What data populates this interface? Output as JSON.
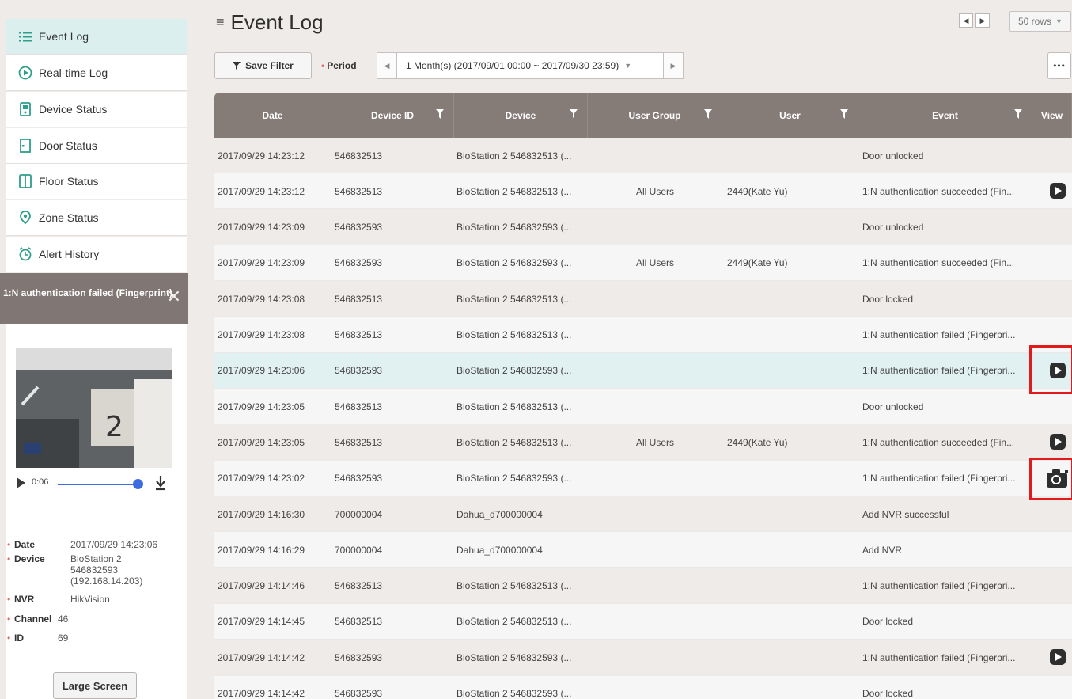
{
  "sidebar": {
    "items": [
      {
        "label": "Event Log",
        "icon": "list-icon",
        "active": true
      },
      {
        "label": "Real-time Log",
        "icon": "play-circle-icon"
      },
      {
        "label": "Device Status",
        "icon": "device-icon"
      },
      {
        "label": "Door Status",
        "icon": "door-icon"
      },
      {
        "label": "Floor Status",
        "icon": "floor-icon"
      },
      {
        "label": "Zone Status",
        "icon": "zone-pin-icon"
      },
      {
        "label": "Alert History",
        "icon": "alarm-clock-icon"
      }
    ],
    "alert": {
      "title": "1:N authentication failed (Fingerprint)",
      "close_icon": "close-icon"
    },
    "player": {
      "time": "0:06",
      "progress_fraction": 0.92
    },
    "details": [
      {
        "key": "Date",
        "value": "2017/09/29 14:23:06"
      },
      {
        "key": "Device",
        "value": "BioStation 2 546832593 (192.168.14.203)"
      },
      {
        "key": "NVR",
        "value": "HikVision"
      },
      {
        "key": "Channel",
        "value": "46"
      },
      {
        "key": "ID",
        "value": "69"
      }
    ],
    "large_screen_label": "Large Screen"
  },
  "header": {
    "title": "Event Log",
    "rows_label": "50 rows",
    "save_filter_label": "Save Filter",
    "period_label": "Period",
    "period_value": "1 Month(s) (2017/09/01 00:00 ~ 2017/09/30 23:59)",
    "more_label": "•••"
  },
  "table": {
    "columns": [
      "Date",
      "Device ID",
      "Device",
      "User Group",
      "User",
      "Event",
      "View"
    ],
    "rows": [
      {
        "date": "2017/09/29 14:23:12",
        "device_id": "546832513",
        "device": "BioStation 2 546832513 (...",
        "user_group": "",
        "user": "",
        "event": "Door unlocked",
        "view": ""
      },
      {
        "date": "2017/09/29 14:23:12",
        "device_id": "546832513",
        "device": "BioStation 2 546832513 (...",
        "user_group": "All Users",
        "user": "2449(Kate Yu)",
        "event": "1:N authentication succeeded (Fin...",
        "view": "video"
      },
      {
        "date": "2017/09/29 14:23:09",
        "device_id": "546832593",
        "device": "BioStation 2 546832593 (...",
        "user_group": "",
        "user": "",
        "event": "Door unlocked",
        "view": ""
      },
      {
        "date": "2017/09/29 14:23:09",
        "device_id": "546832593",
        "device": "BioStation 2 546832593 (...",
        "user_group": "All Users",
        "user": "2449(Kate Yu)",
        "event": "1:N authentication succeeded (Fin...",
        "view": ""
      },
      {
        "date": "2017/09/29 14:23:08",
        "device_id": "546832513",
        "device": "BioStation 2 546832513 (...",
        "user_group": "",
        "user": "",
        "event": "Door locked",
        "view": ""
      },
      {
        "date": "2017/09/29 14:23:08",
        "device_id": "546832513",
        "device": "BioStation 2 546832513 (...",
        "user_group": "",
        "user": "",
        "event": "1:N authentication failed (Fingerpri...",
        "view": ""
      },
      {
        "date": "2017/09/29 14:23:06",
        "device_id": "546832593",
        "device": "BioStation 2 546832593 (...",
        "user_group": "",
        "user": "",
        "event": "1:N authentication failed (Fingerpri...",
        "view": "video",
        "selected": true
      },
      {
        "date": "2017/09/29 14:23:05",
        "device_id": "546832513",
        "device": "BioStation 2 546832513 (...",
        "user_group": "",
        "user": "",
        "event": "Door unlocked",
        "view": ""
      },
      {
        "date": "2017/09/29 14:23:05",
        "device_id": "546832513",
        "device": "BioStation 2 546832513 (...",
        "user_group": "All Users",
        "user": "2449(Kate Yu)",
        "event": "1:N authentication succeeded (Fin...",
        "view": "video"
      },
      {
        "date": "2017/09/29 14:23:02",
        "device_id": "546832593",
        "device": "BioStation 2 546832593 (...",
        "user_group": "",
        "user": "",
        "event": "1:N authentication failed (Fingerpri...",
        "view": "camera"
      },
      {
        "date": "2017/09/29 14:16:30",
        "device_id": "700000004",
        "device": "Dahua_d700000004",
        "user_group": "",
        "user": "",
        "event": "Add NVR successful",
        "view": ""
      },
      {
        "date": "2017/09/29 14:16:29",
        "device_id": "700000004",
        "device": "Dahua_d700000004",
        "user_group": "",
        "user": "",
        "event": "Add NVR",
        "view": ""
      },
      {
        "date": "2017/09/29 14:14:46",
        "device_id": "546832513",
        "device": "BioStation 2 546832513 (...",
        "user_group": "",
        "user": "",
        "event": "1:N authentication failed (Fingerpri...",
        "view": ""
      },
      {
        "date": "2017/09/29 14:14:45",
        "device_id": "546832513",
        "device": "BioStation 2 546832513 (...",
        "user_group": "",
        "user": "",
        "event": "Door locked",
        "view": ""
      },
      {
        "date": "2017/09/29 14:14:42",
        "device_id": "546832593",
        "device": "BioStation 2 546832593 (...",
        "user_group": "",
        "user": "",
        "event": "1:N authentication failed (Fingerpri...",
        "view": "video"
      },
      {
        "date": "2017/09/29 14:14:42",
        "device_id": "546832593",
        "device": "BioStation 2 546832593 (...",
        "user_group": "",
        "user": "",
        "event": "Door locked",
        "view": ""
      }
    ]
  },
  "colors": {
    "header_bg": "#857b77",
    "selected_row": "#e1f0f0",
    "active_nav": "#dcefef",
    "highlight": "#e11b1b",
    "accent_blue": "#3d6be0"
  }
}
